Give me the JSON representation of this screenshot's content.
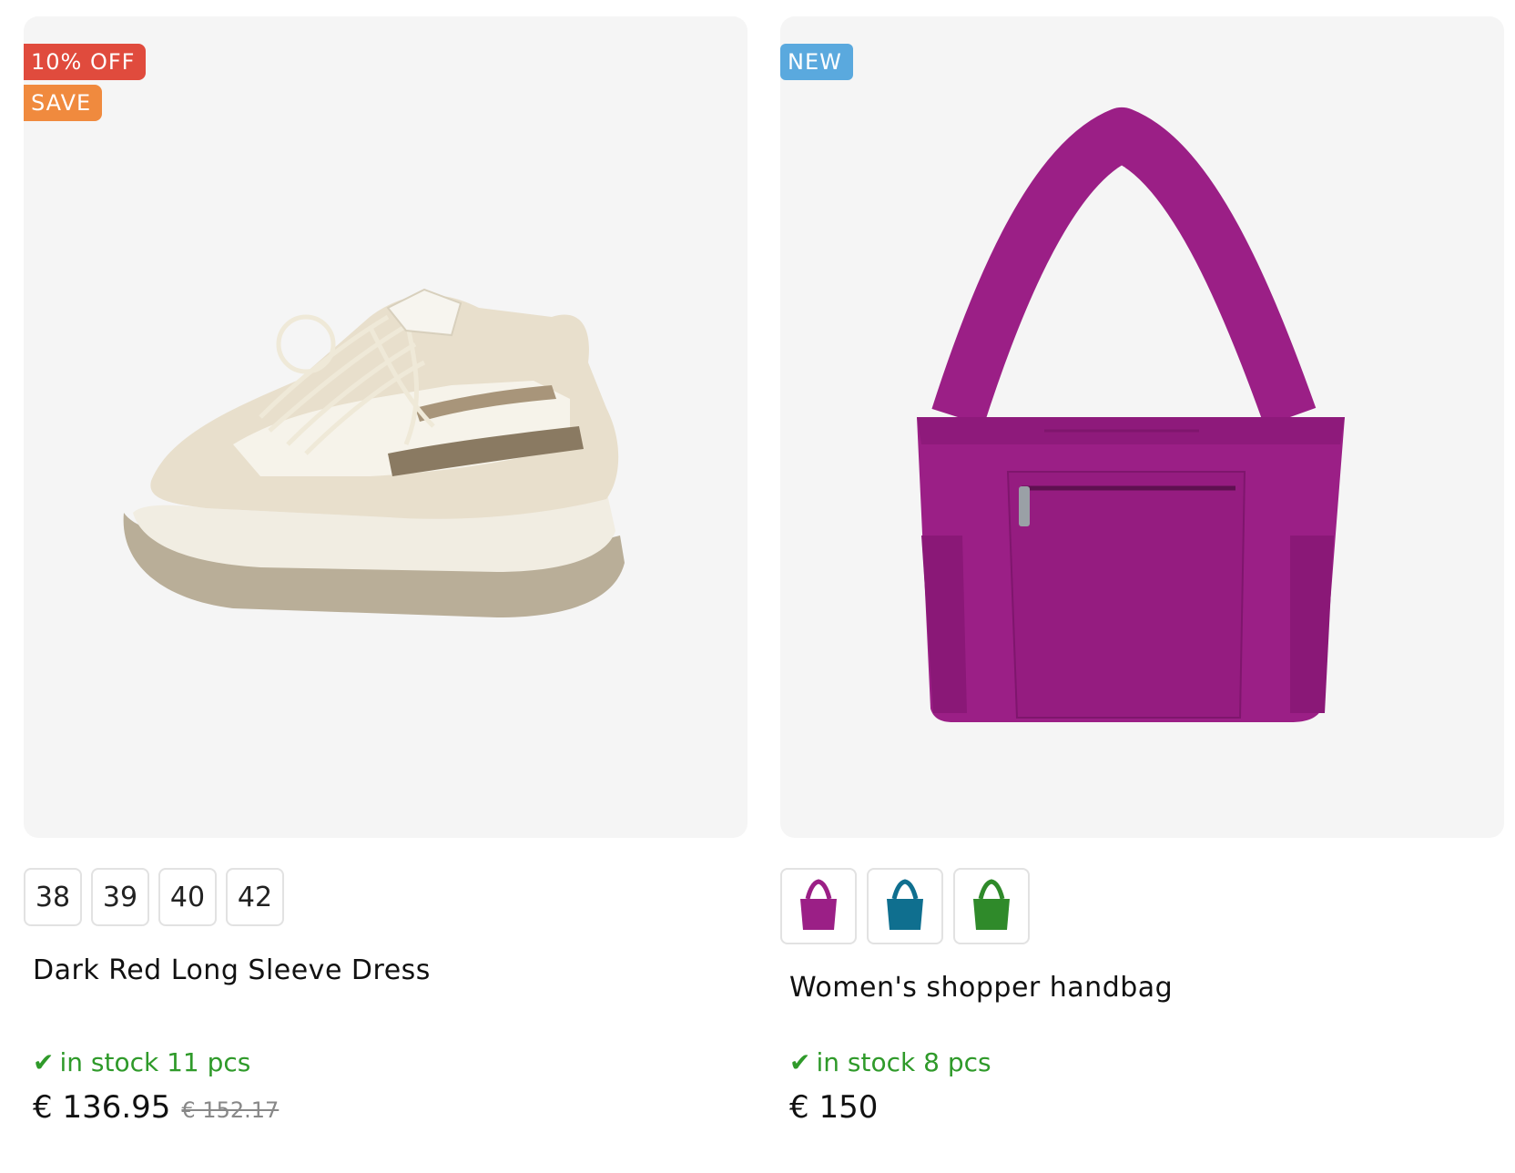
{
  "products": [
    {
      "badges": [
        "10% OFF",
        "SAVE"
      ],
      "image_icon": "sneaker-image",
      "sizes": [
        "38",
        "39",
        "40",
        "42"
      ],
      "title": "Dark Red Long Sleeve Dress",
      "stock": {
        "check": "✔",
        "text": "in stock 11 pcs"
      },
      "price": "€ 136.95",
      "old_price": "€ 152.17"
    },
    {
      "badges": [
        "NEW"
      ],
      "image_icon": "handbag-image",
      "color_swatches": [
        {
          "name": "purple",
          "color": "#9b1f86"
        },
        {
          "name": "teal",
          "color": "#0f6f8f"
        },
        {
          "name": "green",
          "color": "#2f8a2a"
        }
      ],
      "title": "Women's shopper handbag",
      "stock": {
        "check": "✔",
        "text": "in stock 8 pcs"
      },
      "price": "€ 150"
    }
  ],
  "colors": {
    "badge_discount": "#e04b3d",
    "badge_save": "#f08a3e",
    "badge_new": "#5aa9de",
    "stock_green": "#2f9a2a",
    "image_bg": "#f5f5f5"
  }
}
